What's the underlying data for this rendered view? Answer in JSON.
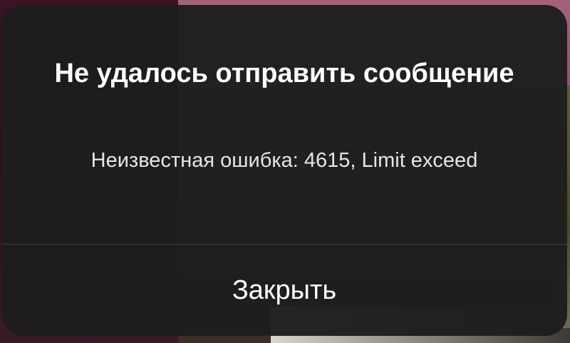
{
  "alert": {
    "title": "Не удалось отправить сообщение",
    "message": "Неизвестная ошибка: 4615, Limit exceed",
    "close_label": "Закрыть"
  },
  "colors": {
    "alert_background": "#1e1e1e",
    "text": "#ffffff",
    "divider": "#3c3c3e"
  }
}
